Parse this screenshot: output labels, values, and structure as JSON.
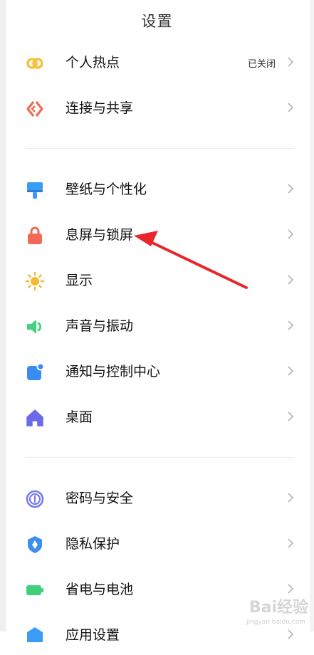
{
  "page": {
    "title": "设置"
  },
  "groups": [
    {
      "items": [
        {
          "label": "个人热点",
          "value": "已关闭",
          "icon": "hotspot-icon",
          "color": "#F4C23B"
        },
        {
          "label": "连接与共享",
          "icon": "connection-share-icon",
          "color": "#EE6B50"
        }
      ]
    },
    {
      "items": [
        {
          "label": "壁纸与个性化",
          "icon": "wallpaper-icon",
          "color": "#3A9CF5"
        },
        {
          "label": "息屏与锁屏",
          "icon": "lock-icon",
          "color": "#F26A57"
        },
        {
          "label": "显示",
          "icon": "brightness-icon",
          "color": "#F5B82E"
        },
        {
          "label": "声音与振动",
          "icon": "sound-icon",
          "color": "#43D27F"
        },
        {
          "label": "通知与控制中心",
          "icon": "notification-icon",
          "color": "#3A8BF2"
        },
        {
          "label": "桌面",
          "icon": "home-icon",
          "color": "#6B6AE8"
        }
      ]
    },
    {
      "items": [
        {
          "label": "密码与安全",
          "icon": "fingerprint-icon",
          "color": "#7A7BEB"
        },
        {
          "label": "隐私保护",
          "icon": "privacy-icon",
          "color": "#3C8EF0"
        },
        {
          "label": "省电与电池",
          "icon": "battery-icon",
          "color": "#40D07C"
        },
        {
          "label": "应用设置",
          "icon": "apps-icon",
          "color": "#3A9CF5"
        }
      ]
    }
  ],
  "annotation": {
    "arrow_color": "#E8262B"
  },
  "watermark": {
    "text": "Bai经验",
    "sub": "jingyan.baidu.com"
  }
}
